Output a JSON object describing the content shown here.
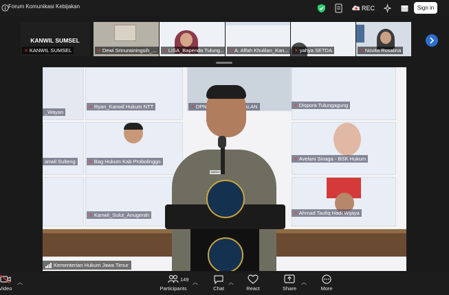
{
  "window": {
    "title": "Forum Komunikasi Kebijakan"
  },
  "topbar": {
    "rec_label": "REC",
    "signin_label": "Sign in"
  },
  "strip": {
    "kanwil_big": "KANWIL SUMSEL",
    "tiles": [
      "KANWIL SUMSEL",
      "Dewi Srinurainingsih_...",
      "LISA_Bapenda Tulung...",
      "A. Affah Khulilan_Kan...",
      "yahya SETDA",
      "Novita Rosalina"
    ]
  },
  "main": {
    "labels": [
      "_Wayan",
      "Ryan_Kanwil Hukum NTT",
      "Dispora Tulungagung",
      "DPN",
      "ALAN",
      "anwil Sulteng",
      "Bag Hukum Kab Probolinggo",
      "Avelani Sinaga - BSK Hukum",
      "Kanwil_Sulut_Anugerah",
      "Ahmad Taufiq Hadi Wijaya"
    ],
    "nameplate": "MARIO",
    "active_speaker": "Kementerian Hukum Jawa Timur"
  },
  "toolbar": {
    "video_label": "Video",
    "participants_label": "Participants",
    "participants_count": "149",
    "chat_label": "Chat",
    "react_label": "React",
    "share_label": "Share",
    "more_label": "More"
  },
  "colors": {
    "accent": "#2d6fcf",
    "mic_muted": "#e23b3b",
    "shield": "#2ecc71"
  }
}
